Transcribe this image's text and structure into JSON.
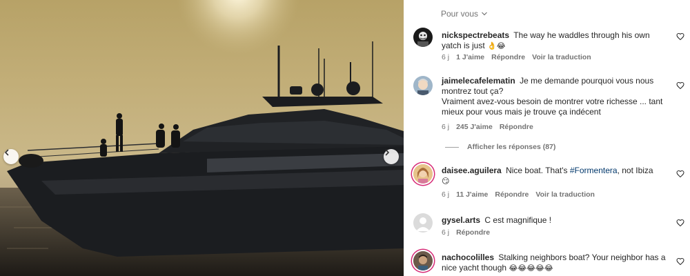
{
  "photo": {
    "alt_icons": {
      "prev": "chevron-left-icon",
      "next": "chevron-right-icon"
    }
  },
  "sort": {
    "label": "Pour vous",
    "icon": "chevron-down-icon"
  },
  "comments": [
    {
      "username": "nickspectrebeats",
      "text": "The way he waddles through his own yatch is just",
      "emoji": "👌😂",
      "age": "6 j",
      "likes": "1 J'aime",
      "reply": "Répondre",
      "translate": "Voir la traduction"
    },
    {
      "username": "jaimelecafelematin",
      "text_line1": "Je me demande pourquoi vous nous",
      "text_line2": "montrez tout ça?",
      "text_line3": "Vraiment avez-vous besoin de montrer votre richesse ... tant",
      "text_line4": "mieux pour vous mais je trouve ça indécent",
      "age": "6 j",
      "likes": "245 J'aime",
      "reply": "Répondre"
    },
    {
      "username": "daisee.aguilera",
      "text_before": "Nice boat. That's",
      "hashtag": "#Formentera",
      "text_after": ", not Ibiza",
      "emoji": "😏",
      "age": "6 j",
      "likes": "11 J'aime",
      "reply": "Répondre",
      "translate": "Voir la traduction"
    },
    {
      "username": "gysel.arts",
      "text": "C est magnifique !",
      "age": "6 j",
      "reply": "Répondre"
    },
    {
      "username": "nachocolilles",
      "text_line1": "Stalking neighbors boat? Your neighbor has a",
      "text_line2": "nice yacht though",
      "emoji": "😂😂😂😂😂"
    }
  ],
  "replies_toggle": "Afficher les réponses (87)",
  "colors": {
    "link": "#00376b",
    "muted": "#737373",
    "story_ring": "#d62976"
  }
}
